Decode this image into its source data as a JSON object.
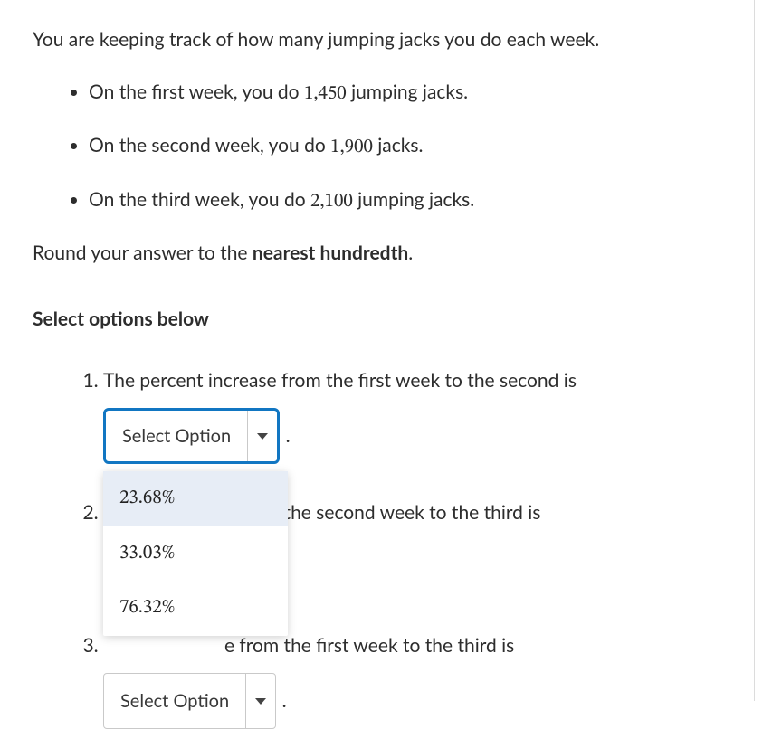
{
  "intro": "You are keeping track of how many jumping jacks you do each week.",
  "bullets": [
    {
      "pre": "On the first week, you do ",
      "num": "1,450",
      "post": " jumping jacks."
    },
    {
      "pre": "On the second week, you do ",
      "num": "1,900",
      "post": " jacks."
    },
    {
      "pre": "On the third week, you do ",
      "num": "2,100",
      "post": " jumping jacks."
    }
  ],
  "round_instr_pre": "Round your answer to the ",
  "round_instr_bold": "nearest hundredth",
  "round_instr_post": ".",
  "select_below": "Select options below",
  "dropdown_placeholder": "Select Option",
  "questions": {
    "q1": "The percent increase from the first week to the second is",
    "q2_partial": "e from the second week to the third is",
    "q3_partial": "e from the first week to the third is"
  },
  "options": [
    "23.68%",
    "33.03%",
    "76.32%"
  ]
}
